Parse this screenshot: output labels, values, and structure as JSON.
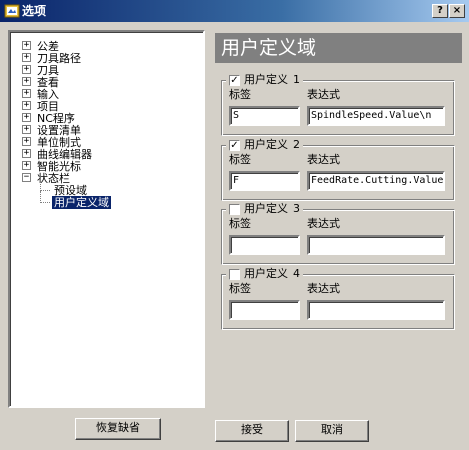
{
  "window": {
    "title": "选项",
    "help_label": "?",
    "close_label": "×"
  },
  "tree": {
    "items": [
      {
        "label": "公差",
        "expander": "+"
      },
      {
        "label": "刀具路径",
        "expander": "+"
      },
      {
        "label": "刀具",
        "expander": "+"
      },
      {
        "label": "查看",
        "expander": "+"
      },
      {
        "label": "输入",
        "expander": "+"
      },
      {
        "label": "项目",
        "expander": "+"
      },
      {
        "label": "NC程序",
        "expander": "+"
      },
      {
        "label": "设置清单",
        "expander": "+"
      },
      {
        "label": "单位制式",
        "expander": "+"
      },
      {
        "label": "曲线编辑器",
        "expander": "+"
      },
      {
        "label": "智能光标",
        "expander": "+"
      },
      {
        "label": "状态栏",
        "expander": "−"
      }
    ],
    "children": [
      {
        "label": "预设域",
        "selected": false
      },
      {
        "label": "用户定义域",
        "selected": true
      }
    ]
  },
  "panel": {
    "title": "用户定义域",
    "groups": [
      {
        "legend": "用户定义",
        "number": "1",
        "checked": true,
        "check_mark": "✓",
        "label_caption": "标签",
        "expr_caption": "表达式",
        "label_value": "S",
        "expr_value": "SpindleSpeed.Value\\n"
      },
      {
        "legend": "用户定义",
        "number": "2",
        "checked": true,
        "check_mark": "✓",
        "label_caption": "标签",
        "expr_caption": "表达式",
        "label_value": "F",
        "expr_value": "FeedRate.Cutting.Value\\"
      },
      {
        "legend": "用户定义",
        "number": "3",
        "checked": false,
        "check_mark": "",
        "label_caption": "标签",
        "expr_caption": "表达式",
        "label_value": "",
        "expr_value": ""
      },
      {
        "legend": "用户定义",
        "number": "4",
        "checked": false,
        "check_mark": "",
        "label_caption": "标签",
        "expr_caption": "表达式",
        "label_value": "",
        "expr_value": ""
      }
    ]
  },
  "buttons": {
    "restore_defaults": "恢复缺省",
    "accept": "接受",
    "cancel": "取消"
  },
  "colors": {
    "face": "#d4d0c8",
    "title_start": "#0a246a",
    "title_end": "#a6caf0",
    "selection": "#0a246a",
    "header_bg": "#808080"
  }
}
